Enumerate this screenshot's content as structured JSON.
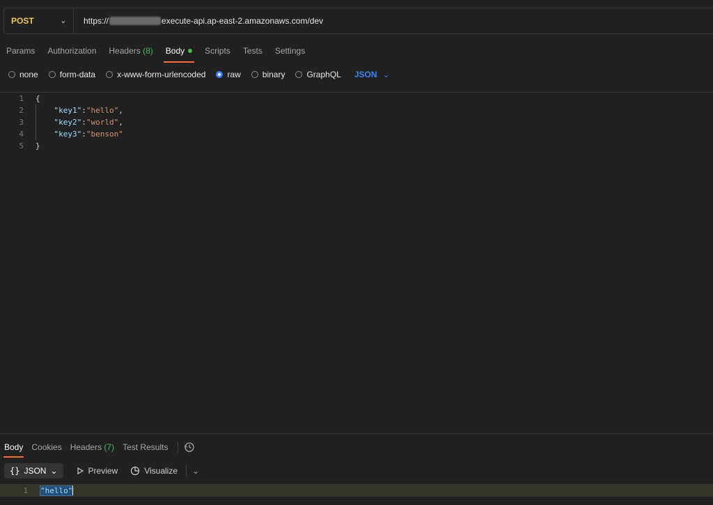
{
  "request": {
    "method": "POST",
    "url_prefix": "https://",
    "url_suffix": "execute-api.ap-east-2.amazonaws.com/dev"
  },
  "request_tabs": [
    {
      "label": "Params"
    },
    {
      "label": "Authorization"
    },
    {
      "label": "Headers",
      "count": "(8)"
    },
    {
      "label": "Body"
    },
    {
      "label": "Scripts"
    },
    {
      "label": "Tests"
    },
    {
      "label": "Settings"
    }
  ],
  "body_types": [
    "none",
    "form-data",
    "x-www-form-urlencoded",
    "raw",
    "binary",
    "GraphQL"
  ],
  "body_type_selected": "raw",
  "format": "JSON",
  "editor_lines": [
    {
      "n": "1",
      "open": "{"
    },
    {
      "n": "2",
      "key": "\"key1\"",
      "val": "\"hello\""
    },
    {
      "n": "3",
      "key": "\"key2\"",
      "val": "\"world\""
    },
    {
      "n": "4",
      "key": "\"key3\"",
      "val": "\"benson\""
    },
    {
      "n": "5",
      "close": "}"
    }
  ],
  "response_tabs": [
    {
      "label": "Body"
    },
    {
      "label": "Cookies"
    },
    {
      "label": "Headers",
      "count": "(7)"
    },
    {
      "label": "Test Results"
    }
  ],
  "response_toolbar": {
    "format_label": "JSON",
    "preview_label": "Preview",
    "visualize_label": "Visualize"
  },
  "response_body": {
    "line": "1",
    "text": "\"hello\""
  },
  "colors": {
    "accent": "#ff6c37",
    "method": "#f2c94c",
    "link": "#3b82f6",
    "count": "#4caf6a"
  }
}
